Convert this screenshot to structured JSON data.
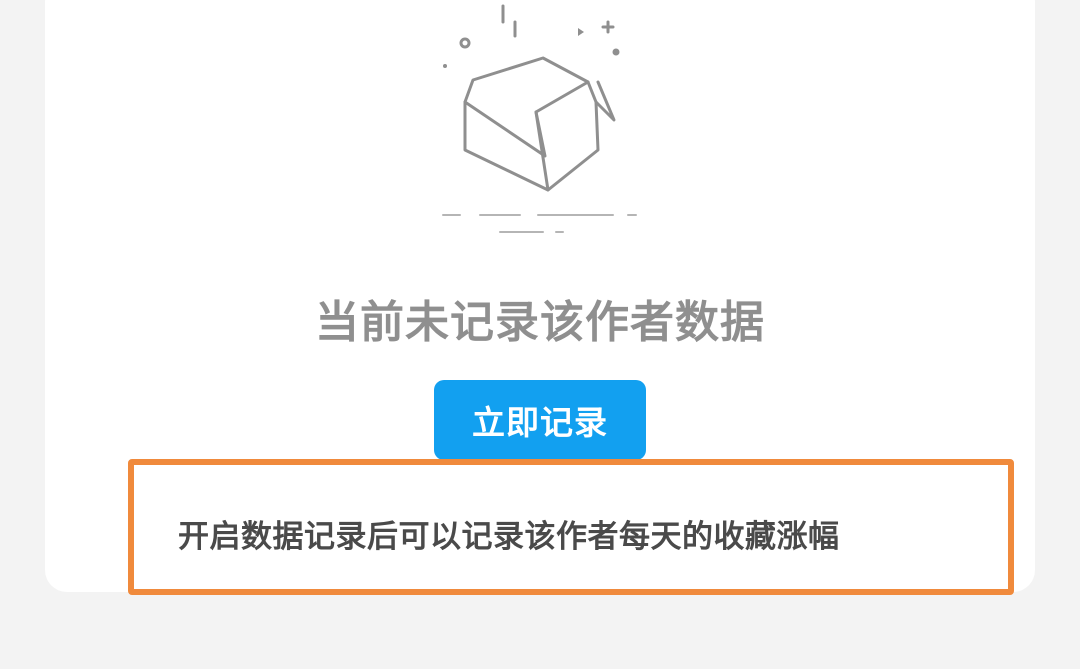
{
  "empty_state": {
    "icon": "open-box-icon",
    "message": "当前未记录该作者数据"
  },
  "actions": {
    "record_now_label": "立即记录"
  },
  "hint": {
    "text": "开启数据记录后可以记录该作者每天的收藏涨幅",
    "highlight_color": "#f08a3c"
  },
  "colors": {
    "accent": "#12a0f0",
    "message": "#8f8f8f",
    "hint_text": "#4a4a4a",
    "background": "#f3f3f3",
    "card": "#ffffff"
  }
}
